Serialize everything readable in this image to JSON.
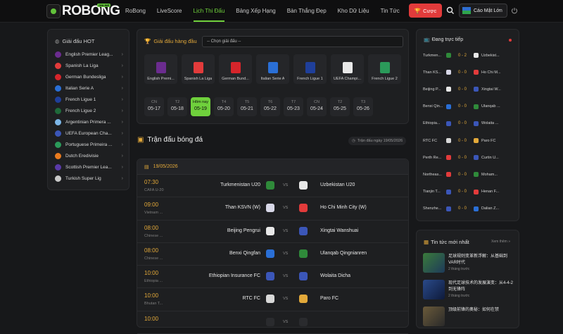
{
  "brand": {
    "name": "ROBONG",
    "badge": "ONLINE"
  },
  "nav": [
    "RoBong",
    "LiveScore",
    "Lịch Thi Đấu",
    "Bảng Xếp Hạng",
    "Bàn Thắng Đẹp",
    "Kho Dữ Liệu",
    "Tin Tức"
  ],
  "nav_active": "Lịch Thi Đấu",
  "header": {
    "bet_label": "Cược",
    "odds_label": "Cáo Mật Lớn"
  },
  "hot_leagues": {
    "title": "Giải đấu HOT",
    "items": [
      {
        "name": "English Premier Leag...",
        "color": "#6b2c8f"
      },
      {
        "name": "Spanish La Liga",
        "color": "#e23b3b"
      },
      {
        "name": "German Bundesliga",
        "color": "#d6252b"
      },
      {
        "name": "Italian Serie A",
        "color": "#2a6fd6"
      },
      {
        "name": "French Ligue 1",
        "color": "#1f3f9a"
      },
      {
        "name": "French Ligue 2",
        "color": "#1f6a3a"
      },
      {
        "name": "Argentinian Primera ...",
        "color": "#7db7e8"
      },
      {
        "name": "UEFA European Cha...",
        "color": "#3b56b8"
      },
      {
        "name": "Portuguese Primeira ...",
        "color": "#2b9a5a"
      },
      {
        "name": "Dutch Eredivisie",
        "color": "#e87a1e"
      },
      {
        "name": "Scottish Premier Lea...",
        "color": "#5a3aa8"
      },
      {
        "name": "Turkish Super Lig",
        "color": "#c9c9c9"
      }
    ]
  },
  "filter": {
    "title": "Giải đấu hàng đầu",
    "select_placeholder": "-- Chọn giải đấu --"
  },
  "top_leagues": [
    {
      "name": "English Premi...",
      "color": "#6b2c8f"
    },
    {
      "name": "Spanish La Liga",
      "color": "#e23b3b"
    },
    {
      "name": "German Bund...",
      "color": "#d6252b"
    },
    {
      "name": "Italian Serie A",
      "color": "#2a6fd6"
    },
    {
      "name": "French Ligue 1",
      "color": "#1f3f9a"
    },
    {
      "name": "UEFA Champi...",
      "color": "#e8e8e8"
    },
    {
      "name": "French Ligue 2",
      "color": "#2b9a5a"
    }
  ],
  "dates": [
    {
      "dow": "CN",
      "date": "05-17"
    },
    {
      "dow": "T2",
      "date": "05-18"
    },
    {
      "dow": "Hôm nay",
      "date": "05-19",
      "active": true
    },
    {
      "dow": "T4",
      "date": "05-20"
    },
    {
      "dow": "T5",
      "date": "05-21"
    },
    {
      "dow": "T6",
      "date": "05-22"
    },
    {
      "dow": "T7",
      "date": "05-23"
    },
    {
      "dow": "CN",
      "date": "05-24"
    },
    {
      "dow": "T2",
      "date": "05-25"
    },
    {
      "dow": "T3",
      "date": "05-26"
    }
  ],
  "matches_section": {
    "title": "Trận đấu bóng đá",
    "date_note": "Trận đấu ngày 19/05/2026",
    "group_date": "19/05/2026",
    "vs_label": "VS"
  },
  "matches": [
    {
      "time": "07:30",
      "league": "CAFA U-20",
      "home": "Turkmenistan U20",
      "away": "Uzbekistan U20",
      "hc": "#2f8a3a",
      "ac": "#e8e8e8"
    },
    {
      "time": "09:00",
      "league": "Vietnam ...",
      "home": "Than KSVN (W)",
      "away": "Ho Chi Minh City (W)",
      "hc": "#d8d8e8",
      "ac": "#e23b3b"
    },
    {
      "time": "08:00",
      "league": "Chinese ...",
      "home": "Beijing Pengrui",
      "away": "Xingtai Wanshuai",
      "hc": "#e8e8e8",
      "ac": "#3b56b8"
    },
    {
      "time": "08:00",
      "league": "Chinese ...",
      "home": "Benxi Qingfan",
      "away": "Ulanqab Qingnianren",
      "hc": "#2a6fd6",
      "ac": "#2f8a3a"
    },
    {
      "time": "10:00",
      "league": "Ethiopia ...",
      "home": "Ethiopian Insurance FC",
      "away": "Wolaita Dicha",
      "hc": "#3b56b8",
      "ac": "#3b56b8"
    },
    {
      "time": "10:00",
      "league": "Bhutan T...",
      "home": "RTC FC",
      "away": "Paro FC",
      "hc": "#d8d8d8",
      "ac": "#e3a93a"
    },
    {
      "time": "10:00",
      "league": "",
      "home": "",
      "away": "",
      "hc": "#2a2b2e",
      "ac": "#2a2b2e"
    }
  ],
  "live": {
    "title": "Đang trực tiếp",
    "rows": [
      {
        "home": "Turkmen...",
        "score": "0 - 2",
        "away": "Uzbekist...",
        "hc": "#2f8a3a",
        "ac": "#e8e8e8"
      },
      {
        "home": "Than KS...",
        "score": "0 - 0",
        "away": "Ho Chi M...",
        "hc": "#d8d8e8",
        "ac": "#e23b3b"
      },
      {
        "home": "Beijing P...",
        "score": "0 - 0",
        "away": "Xingtai W...",
        "hc": "#e8e8e8",
        "ac": "#3b56b8"
      },
      {
        "home": "Benxi Qin...",
        "score": "0 - 0",
        "away": "Ulanqab ...",
        "hc": "#2a6fd6",
        "ac": "#2f8a3a"
      },
      {
        "home": "Ethiopia...",
        "score": "0 - 0",
        "away": "Wolaita ...",
        "hc": "#3b56b8",
        "ac": "#3b56b8"
      },
      {
        "home": "RTC FC",
        "score": "0 - 0",
        "away": "Paro FC",
        "hc": "#d8d8d8",
        "ac": "#e3a93a"
      },
      {
        "home": "Perth Re...",
        "score": "0 - 0",
        "away": "Curtin U...",
        "hc": "#e23b3b",
        "ac": "#3b56b8"
      },
      {
        "home": "Northeas...",
        "score": "0 - 0",
        "away": "Moham...",
        "hc": "#e23b3b",
        "ac": "#2f8a3a"
      },
      {
        "home": "Tianjin T...",
        "score": "0 - 0",
        "away": "Henan F...",
        "hc": "#3b56b8",
        "ac": "#e23b3b"
      },
      {
        "home": "Shenzhe...",
        "score": "0 - 0",
        "away": "Dalian Z...",
        "hc": "#3b56b8",
        "ac": "#2a6fd6"
      }
    ]
  },
  "news": {
    "title": "Tin tức mới nhất",
    "more": "Xem thêm »",
    "items": [
      {
        "title": "足球规则变革新浮解：从基础到VAR时代",
        "time": "2 tháng trước",
        "c1": "#3a7a3a",
        "c2": "#1e3a5a"
      },
      {
        "title": "现代足球技术的发展演变：从4-4-2到无锋阵",
        "time": "2 tháng trước",
        "c1": "#2a4a8a",
        "c2": "#0e1a3a"
      },
      {
        "title": "顶级前锋的奥秘：如何在禁",
        "time": "",
        "c1": "#6a5a3a",
        "c2": "#2a2a2a"
      }
    ]
  },
  "colors": {
    "accent": "#6fd03c",
    "gold": "#e3a93a",
    "danger": "#e23b3b"
  }
}
